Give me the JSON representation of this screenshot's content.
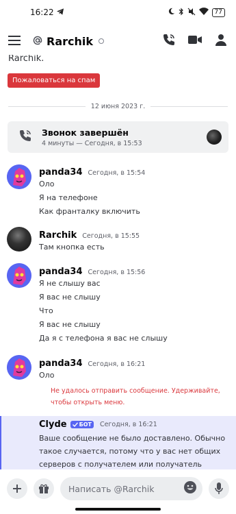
{
  "statusbar": {
    "time": "16:22",
    "battery": "77"
  },
  "header": {
    "username": "Rarchik"
  },
  "chat": {
    "previous_text": "Rarchik.",
    "spam_button": "Пожаловаться на спам",
    "date_divider": "12 июня 2023 г.",
    "call": {
      "title": "Звонок завершён",
      "subtitle": "4 минуты — Сегодня, в 15:53"
    },
    "messages": [
      {
        "author": "panda34",
        "time": "Сегодня, в 15:54",
        "lines": [
          "Оло",
          "Я на телефоне",
          "Как франталку включить"
        ]
      },
      {
        "author": "Rarchik",
        "time": "Сегодня, в 15:55",
        "lines": [
          "Там кнопка есть"
        ]
      },
      {
        "author": "panda34",
        "time": "Сегодня, в 15:56",
        "lines": [
          "Я не слышу вас",
          "Я вас не слышу",
          "Что",
          "Я вас не слышу",
          "Да я с телефона я вас не слышу"
        ]
      },
      {
        "author": "panda34",
        "time": "Сегодня, в 16:21",
        "lines": [
          "Оло"
        ]
      }
    ],
    "error_line1": "Не удалось отправить сообщение. Удерживайте,",
    "error_line2": "чтобы открыть меню.",
    "clyde": {
      "author": "Clyde",
      "badge": "БОТ",
      "time": "Сегодня, в 16:21",
      "line1": "Ваше сообщение не было доставлено. Обычно",
      "line2": "такое случается, потому что у вас нет общих",
      "line3": "серверов с получателем или получатель"
    }
  },
  "composer": {
    "placeholder": "Написать @Rarchik"
  },
  "colors": {
    "accent": "#5865f2",
    "danger": "#da373c",
    "clyde_bg": "#e9eafc"
  },
  "icons": [
    "telegram-icon",
    "moon-icon",
    "bluetooth-icon",
    "mute-icon",
    "wifi-icon",
    "menu-icon",
    "at-icon",
    "phone-icon",
    "video-icon",
    "members-icon",
    "call-ended-icon",
    "plus-icon",
    "gift-icon",
    "emoji-icon",
    "microphone-icon"
  ]
}
